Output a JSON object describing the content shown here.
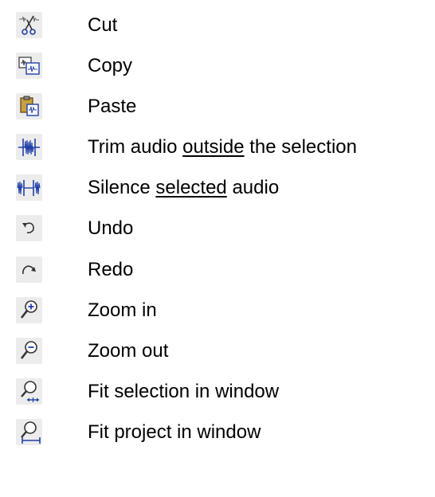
{
  "toolbar_legend": {
    "items": [
      {
        "icon": "cut-icon",
        "label": "Cut"
      },
      {
        "icon": "copy-icon",
        "label": "Copy"
      },
      {
        "icon": "paste-icon",
        "label": "Paste"
      },
      {
        "icon": "trim-audio-icon",
        "label_before": "Trim audio ",
        "label_emphasis": "outside",
        "label_after": " the selection"
      },
      {
        "icon": "silence-audio-icon",
        "label_before": "Silence ",
        "label_emphasis": "selected",
        "label_after": " audio"
      },
      {
        "icon": "undo-icon",
        "label": "Undo"
      },
      {
        "icon": "redo-icon",
        "label": "Redo"
      },
      {
        "icon": "zoom-in-icon",
        "label": "Zoom in"
      },
      {
        "icon": "zoom-out-icon",
        "label": "Zoom out"
      },
      {
        "icon": "fit-selection-icon",
        "label": "Fit selection in window"
      },
      {
        "icon": "fit-project-icon",
        "label": "Fit project in window"
      }
    ]
  },
  "colors": {
    "button_background": "#ececec",
    "text": "#000000",
    "icon_blue": "#1f3fa8",
    "icon_dark": "#333333",
    "clipboard_tan": "#c8a040"
  }
}
